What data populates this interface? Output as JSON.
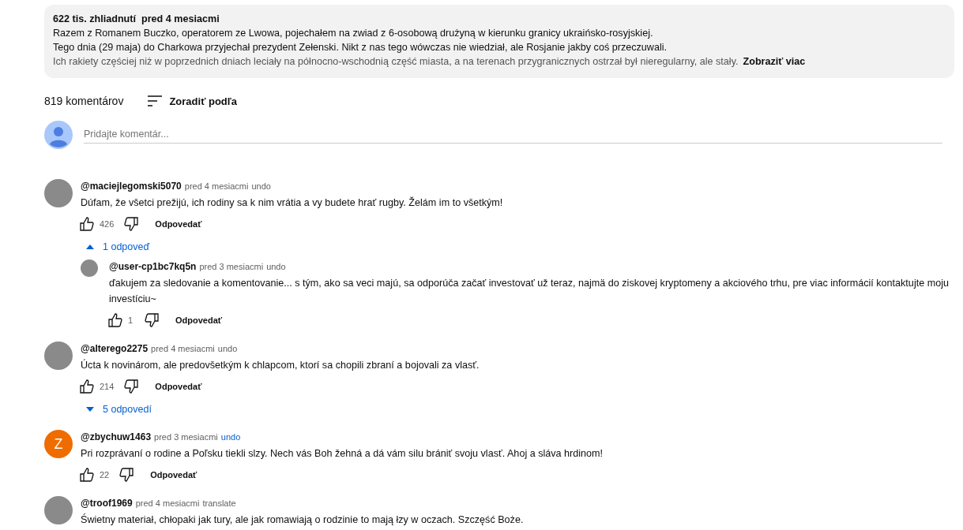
{
  "description": {
    "stats": "622 tis. zhliadnutí  pred 4 mesiacmi",
    "lines": [
      "Razem z Romanem Buczko, operatorem ze Lwowa, pojechałem na zwiad z 6-osobową drużyną w kierunku granicy ukraińsko-rosyjskiej.",
      "Tego dnia (29 maja) do Charkowa przyjechał prezydent Zełenski. Nikt z nas tego wówczas nie wiedział, ale Rosjanie jakby coś przeczuwali.",
      "Ich rakiety częściej niż w poprzednich dniach leciały na północno-wschodnią część miasta, a na terenach przygranicznych ostrzał był nieregularny, ale stały."
    ],
    "more": "Zobraziť viac"
  },
  "comments_header": {
    "count": "819 komentárov",
    "sort": "Zoradiť podľa"
  },
  "add_comment": {
    "placeholder": "Pridajte komentár..."
  },
  "comments": [
    {
      "author": "@maciejlegomski5070",
      "time": "pred 4 mesiacmi",
      "translate": "undo",
      "translate_highlighted": false,
      "avatar": {
        "kind": "photo"
      },
      "text": "Dúfam, že všetci prežijú, ich rodiny sa k nim vrátia a vy budete hrať rugby. Želám im to všetkým!",
      "likes": "426",
      "reply": "Odpovedať",
      "replies_toggle": {
        "label": "1 odpoveď",
        "expanded": true
      },
      "replies": [
        {
          "author": "@user-cp1bc7kq5n",
          "time": "pred 3 mesiacmi",
          "translate": "undo",
          "translate_highlighted": false,
          "avatar": {
            "kind": "photo"
          },
          "text": "ďakujem za sledovanie a komentovanie... s tým, ako sa veci majú, sa odporúča začať investovať už teraz, najmä do ziskovej kryptomeny a akciového trhu, pre viac informácií kontaktujte moju investíciu~",
          "likes": "1",
          "reply": "Odpovedať"
        }
      ]
    },
    {
      "author": "@alterego2275",
      "time": "pred 4 mesiacmi",
      "translate": "undo",
      "translate_highlighted": false,
      "avatar": {
        "kind": "photo"
      },
      "text": "Úcta k novinárom, ale predovšetkým k chlapcom, ktorí sa chopili zbraní a bojovali za vlasť.",
      "likes": "214",
      "reply": "Odpovedať",
      "replies_toggle": {
        "label": "5 odpovedí",
        "expanded": false
      }
    },
    {
      "author": "@zbychuw1463",
      "time": "pred 3 mesiacmi",
      "translate": "undo",
      "translate_highlighted": true,
      "avatar": {
        "kind": "letter",
        "letter": "Z",
        "color": "#ef6c00"
      },
      "text": "Pri rozprávaní o rodine a Poľsku tiekli slzy. Nech vás Boh žehná a dá vám silu brániť svoju vlasť. Ahoj a sláva hrdinom!",
      "likes": "22",
      "reply": "Odpovedať"
    },
    {
      "author": "@troof1969",
      "time": "pred 4 mesiacmi",
      "translate": "translate",
      "translate_highlighted": false,
      "avatar": {
        "kind": "photo"
      },
      "text": "Świetny materiał, chłopaki jak tury, ale jak romawiają o rodzinie to mają łzy w oczach. Szczęść Boże."
    }
  ]
}
